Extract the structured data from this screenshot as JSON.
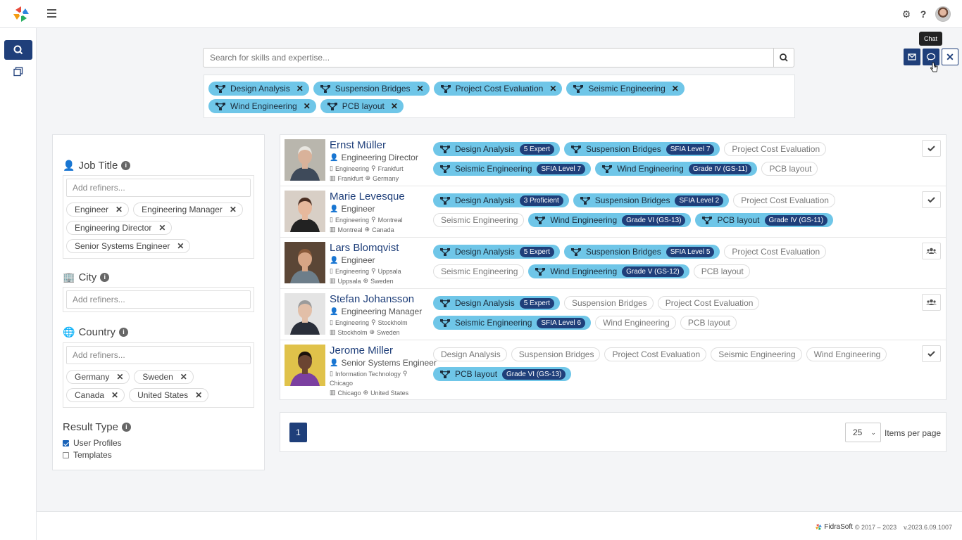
{
  "search": {
    "placeholder": "Search for skills and expertise..."
  },
  "search_filters": [
    {
      "label": "Design Analysis"
    },
    {
      "label": "Suspension Bridges"
    },
    {
      "label": "Project Cost Evaluation"
    },
    {
      "label": "Seismic Engineering"
    },
    {
      "label": "Wind Engineering"
    },
    {
      "label": "PCB layout"
    }
  ],
  "actions": {
    "tooltip": "Chat"
  },
  "refiners": {
    "job_title": {
      "title": "Job Title",
      "placeholder": "Add refiners...",
      "tags": [
        "Engineer",
        "Engineering Manager",
        "Engineering Director",
        "Senior Systems Engineer"
      ]
    },
    "city": {
      "title": "City",
      "placeholder": "Add refiners...",
      "tags": []
    },
    "country": {
      "title": "Country",
      "placeholder": "Add refiners...",
      "tags": [
        "Germany",
        "Sweden",
        "Canada",
        "United States"
      ]
    },
    "result_type": {
      "title": "Result Type",
      "options": [
        {
          "label": "User Profiles",
          "checked": true
        },
        {
          "label": "Templates",
          "checked": false
        }
      ]
    }
  },
  "results": [
    {
      "name": "Ernst Müller",
      "title": "Engineering Director",
      "department": "Engineering",
      "office": "Frankfurt",
      "city": "Frankfurt",
      "country": "Germany",
      "action_icon": "check-icon",
      "skills": [
        {
          "label": "Design Analysis",
          "level": "5 Expert",
          "matched": true
        },
        {
          "label": "Suspension Bridges",
          "level": "SFIA Level 7",
          "matched": true
        },
        {
          "label": "Project Cost Evaluation",
          "level": null,
          "matched": false
        },
        {
          "label": "Seismic Engineering",
          "level": "SFIA Level 7",
          "matched": true
        },
        {
          "label": "Wind Engineering",
          "level": "Grade IV (GS-11)",
          "matched": true
        },
        {
          "label": "PCB layout",
          "level": null,
          "matched": false
        }
      ]
    },
    {
      "name": "Marie Levesque",
      "title": "Engineer",
      "department": "Engineering",
      "office": "Montreal",
      "city": "Montreal",
      "country": "Canada",
      "action_icon": "check-icon",
      "skills": [
        {
          "label": "Design Analysis",
          "level": "3 Proficient",
          "matched": true
        },
        {
          "label": "Suspension Bridges",
          "level": "SFIA Level 2",
          "matched": true
        },
        {
          "label": "Project Cost Evaluation",
          "level": null,
          "matched": false
        },
        {
          "label": "Seismic Engineering",
          "level": null,
          "matched": false
        },
        {
          "label": "Wind Engineering",
          "level": "Grade VI (GS-13)",
          "matched": true
        },
        {
          "label": "PCB layout",
          "level": "Grade IV (GS-11)",
          "matched": true
        }
      ]
    },
    {
      "name": "Lars Blomqvist",
      "title": "Engineer",
      "department": "Engineering",
      "office": "Uppsala",
      "city": "Uppsala",
      "country": "Sweden",
      "action_icon": "team-icon",
      "skills": [
        {
          "label": "Design Analysis",
          "level": "5 Expert",
          "matched": true
        },
        {
          "label": "Suspension Bridges",
          "level": "SFIA Level 5",
          "matched": true
        },
        {
          "label": "Project Cost Evaluation",
          "level": null,
          "matched": false
        },
        {
          "label": "Seismic Engineering",
          "level": null,
          "matched": false
        },
        {
          "label": "Wind Engineering",
          "level": "Grade V (GS-12)",
          "matched": true
        },
        {
          "label": "PCB layout",
          "level": null,
          "matched": false
        }
      ]
    },
    {
      "name": "Stefan Johansson",
      "title": "Engineering Manager",
      "department": "Engineering",
      "office": "Stockholm",
      "city": "Stockholm",
      "country": "Sweden",
      "action_icon": "team-icon",
      "skills": [
        {
          "label": "Design Analysis",
          "level": "5 Expert",
          "matched": true
        },
        {
          "label": "Suspension Bridges",
          "level": null,
          "matched": false
        },
        {
          "label": "Project Cost Evaluation",
          "level": null,
          "matched": false
        },
        {
          "label": "Seismic Engineering",
          "level": "SFIA Level 6",
          "matched": true
        },
        {
          "label": "Wind Engineering",
          "level": null,
          "matched": false
        },
        {
          "label": "PCB layout",
          "level": null,
          "matched": false
        }
      ]
    },
    {
      "name": "Jerome Miller",
      "title": "Senior Systems Engineer",
      "department": "Information Technology",
      "office": "Chicago",
      "city": "Chicago",
      "country": "United States",
      "action_icon": "check-icon",
      "skills": [
        {
          "label": "Design Analysis",
          "level": null,
          "matched": false
        },
        {
          "label": "Suspension Bridges",
          "level": null,
          "matched": false
        },
        {
          "label": "Project Cost Evaluation",
          "level": null,
          "matched": false
        },
        {
          "label": "Seismic Engineering",
          "level": null,
          "matched": false
        },
        {
          "label": "Wind Engineering",
          "level": null,
          "matched": false
        },
        {
          "label": "PCB layout",
          "level": "Grade VI (GS-13)",
          "matched": true
        }
      ]
    }
  ],
  "pagination": {
    "current_page": "1",
    "per_page": "25",
    "per_page_label": "Items per page"
  },
  "footer": {
    "brand": "FidraSoft",
    "copyright": "© 2017 – 2023",
    "version": "v.2023.6.09.1007"
  },
  "colors": {
    "primary": "#1f3f7a",
    "skill_chip": "#6fc6e8"
  }
}
